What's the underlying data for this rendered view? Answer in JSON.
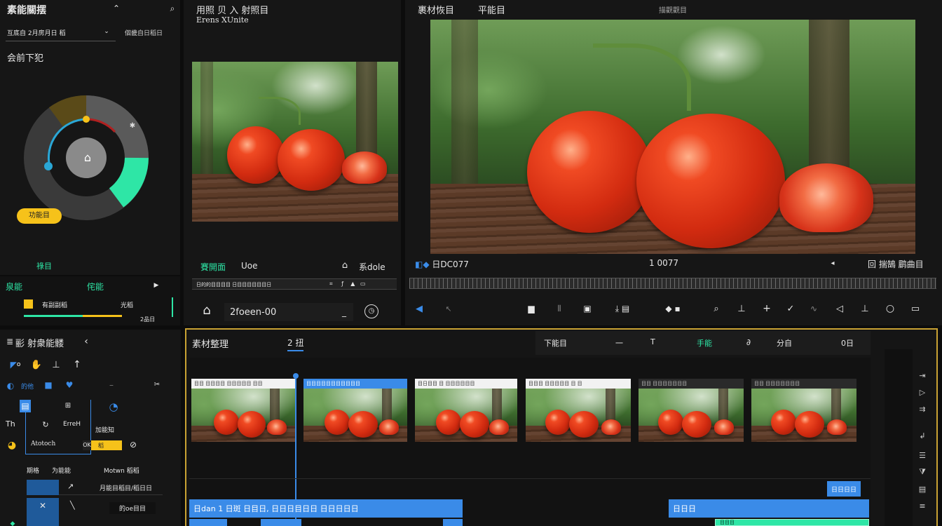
{
  "colors": {
    "accent_teal": "#2ee6a6",
    "accent_yellow": "#f6c21a",
    "accent_blue": "#3a8be8",
    "timeline_border": "#c9a233"
  },
  "media_panel": {
    "title": "素能關摆",
    "collapse_icon": "chevron-up-icon",
    "search_icon": "search-icon",
    "filter_label": "互底自 2月房月日 稻",
    "filter_right": "個畿自日稻日",
    "section_title": "会前下犯",
    "badge_label": "功能目",
    "bottom_label": "祿目"
  },
  "mini_panel": {
    "left_label": "泉能",
    "right_label": "侘能",
    "row_label": "有副副稻",
    "row_value": "光稻",
    "counter": "2品日"
  },
  "source_panel": {
    "title": "用照 贝 入 射照目",
    "subtitle": "Erens XUnite",
    "tab_active": "賽開面",
    "tab_other": "Uoe",
    "tab_right": "系dole",
    "info_line": "日的的目目目目 日目目目目目目日",
    "timecode": "2foeen-00",
    "expand_icon": "double-chevron-right-icon"
  },
  "program_panel": {
    "title": "裹材恢目",
    "title2": "平能目",
    "header_right": "描觀觀目",
    "left_badges": "日DC077",
    "timecode": "1   0077",
    "right_label": "回 揣鵠 鹛曲目",
    "zoom_icon": "zoom-icon"
  },
  "tools_panel": {
    "title": "彨 射衆能髅",
    "row2_label": "的他",
    "row3_a": "Th",
    "row3_b": "ErreH",
    "row3_c": "加能知",
    "row4_label": "Atotoch",
    "row4_badge": "稻",
    "table_header_a": "期格",
    "table_header_b": "为能能",
    "table_header_c": "Motwn 稻稻",
    "table_row1": "月能目稻目/稻日日",
    "table_row2": "的oe目目"
  },
  "timeline": {
    "title": "素材整理",
    "tab2": "2 扭",
    "header_items": [
      "下能目",
      "一",
      "T",
      "手能",
      "分自",
      "0日"
    ],
    "clip_labels": [
      "目目 目目目目 目目目目目 目目",
      "目目目目目目目目目目目",
      "目日目目 目 目目目目目目",
      "目目目 目目目目目 目 目",
      "目目 目目目目目目目",
      "目目 目目目目目目目"
    ],
    "audio_a": "日dan 1 日斑 日目日, 日日日目日日 日日日日日",
    "audio_b": "日日日",
    "tag_a": "日日日日",
    "tag_b": "目目目"
  }
}
